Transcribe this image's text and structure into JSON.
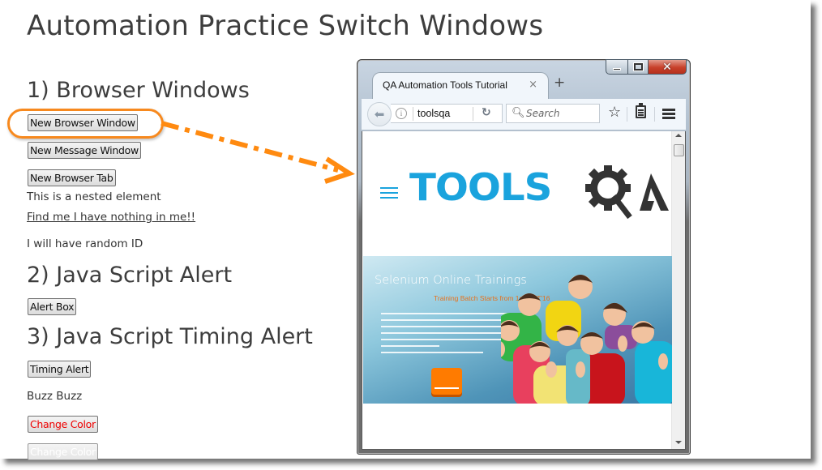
{
  "page": {
    "title": "Automation Practice Switch Windows",
    "sections": [
      {
        "heading": "1) Browser Windows"
      },
      {
        "heading": "2) Java Script Alert"
      },
      {
        "heading": "3) Java Script Timing Alert"
      }
    ],
    "buttons": {
      "new_browser_window": "New Browser Window",
      "new_message_window": "New Message Window",
      "new_browser_tab": "New Browser Tab",
      "alert_box": "Alert Box",
      "timing_alert": "Timing Alert",
      "change_color_red": "Change Color",
      "change_color_faded": "Change Color"
    },
    "texts": {
      "nested_element": "This is a nested element",
      "find_me_link": "Find me I have nothing in me!!",
      "random_id": "I will have random ID",
      "buzz": "Buzz Buzz"
    }
  },
  "annotation": {
    "highlight_color": "#f7891e",
    "arrow_target": "new browser window"
  },
  "browser": {
    "tab_title": "QA Automation Tools Tutorial",
    "tab_close_icon": "×",
    "new_tab_icon": "+",
    "url": "toolsqa",
    "search_placeholder": "Search",
    "window_controls": [
      "minimize",
      "maximize",
      "close"
    ],
    "site": {
      "logo_text": "TOOLS",
      "logo_suffix": "QA",
      "brand_color": "#1aa3dd",
      "banner": {
        "title": "Selenium Online Trainings",
        "subtitle": "Training Batch Starts from 1st OCT'16"
      }
    }
  }
}
